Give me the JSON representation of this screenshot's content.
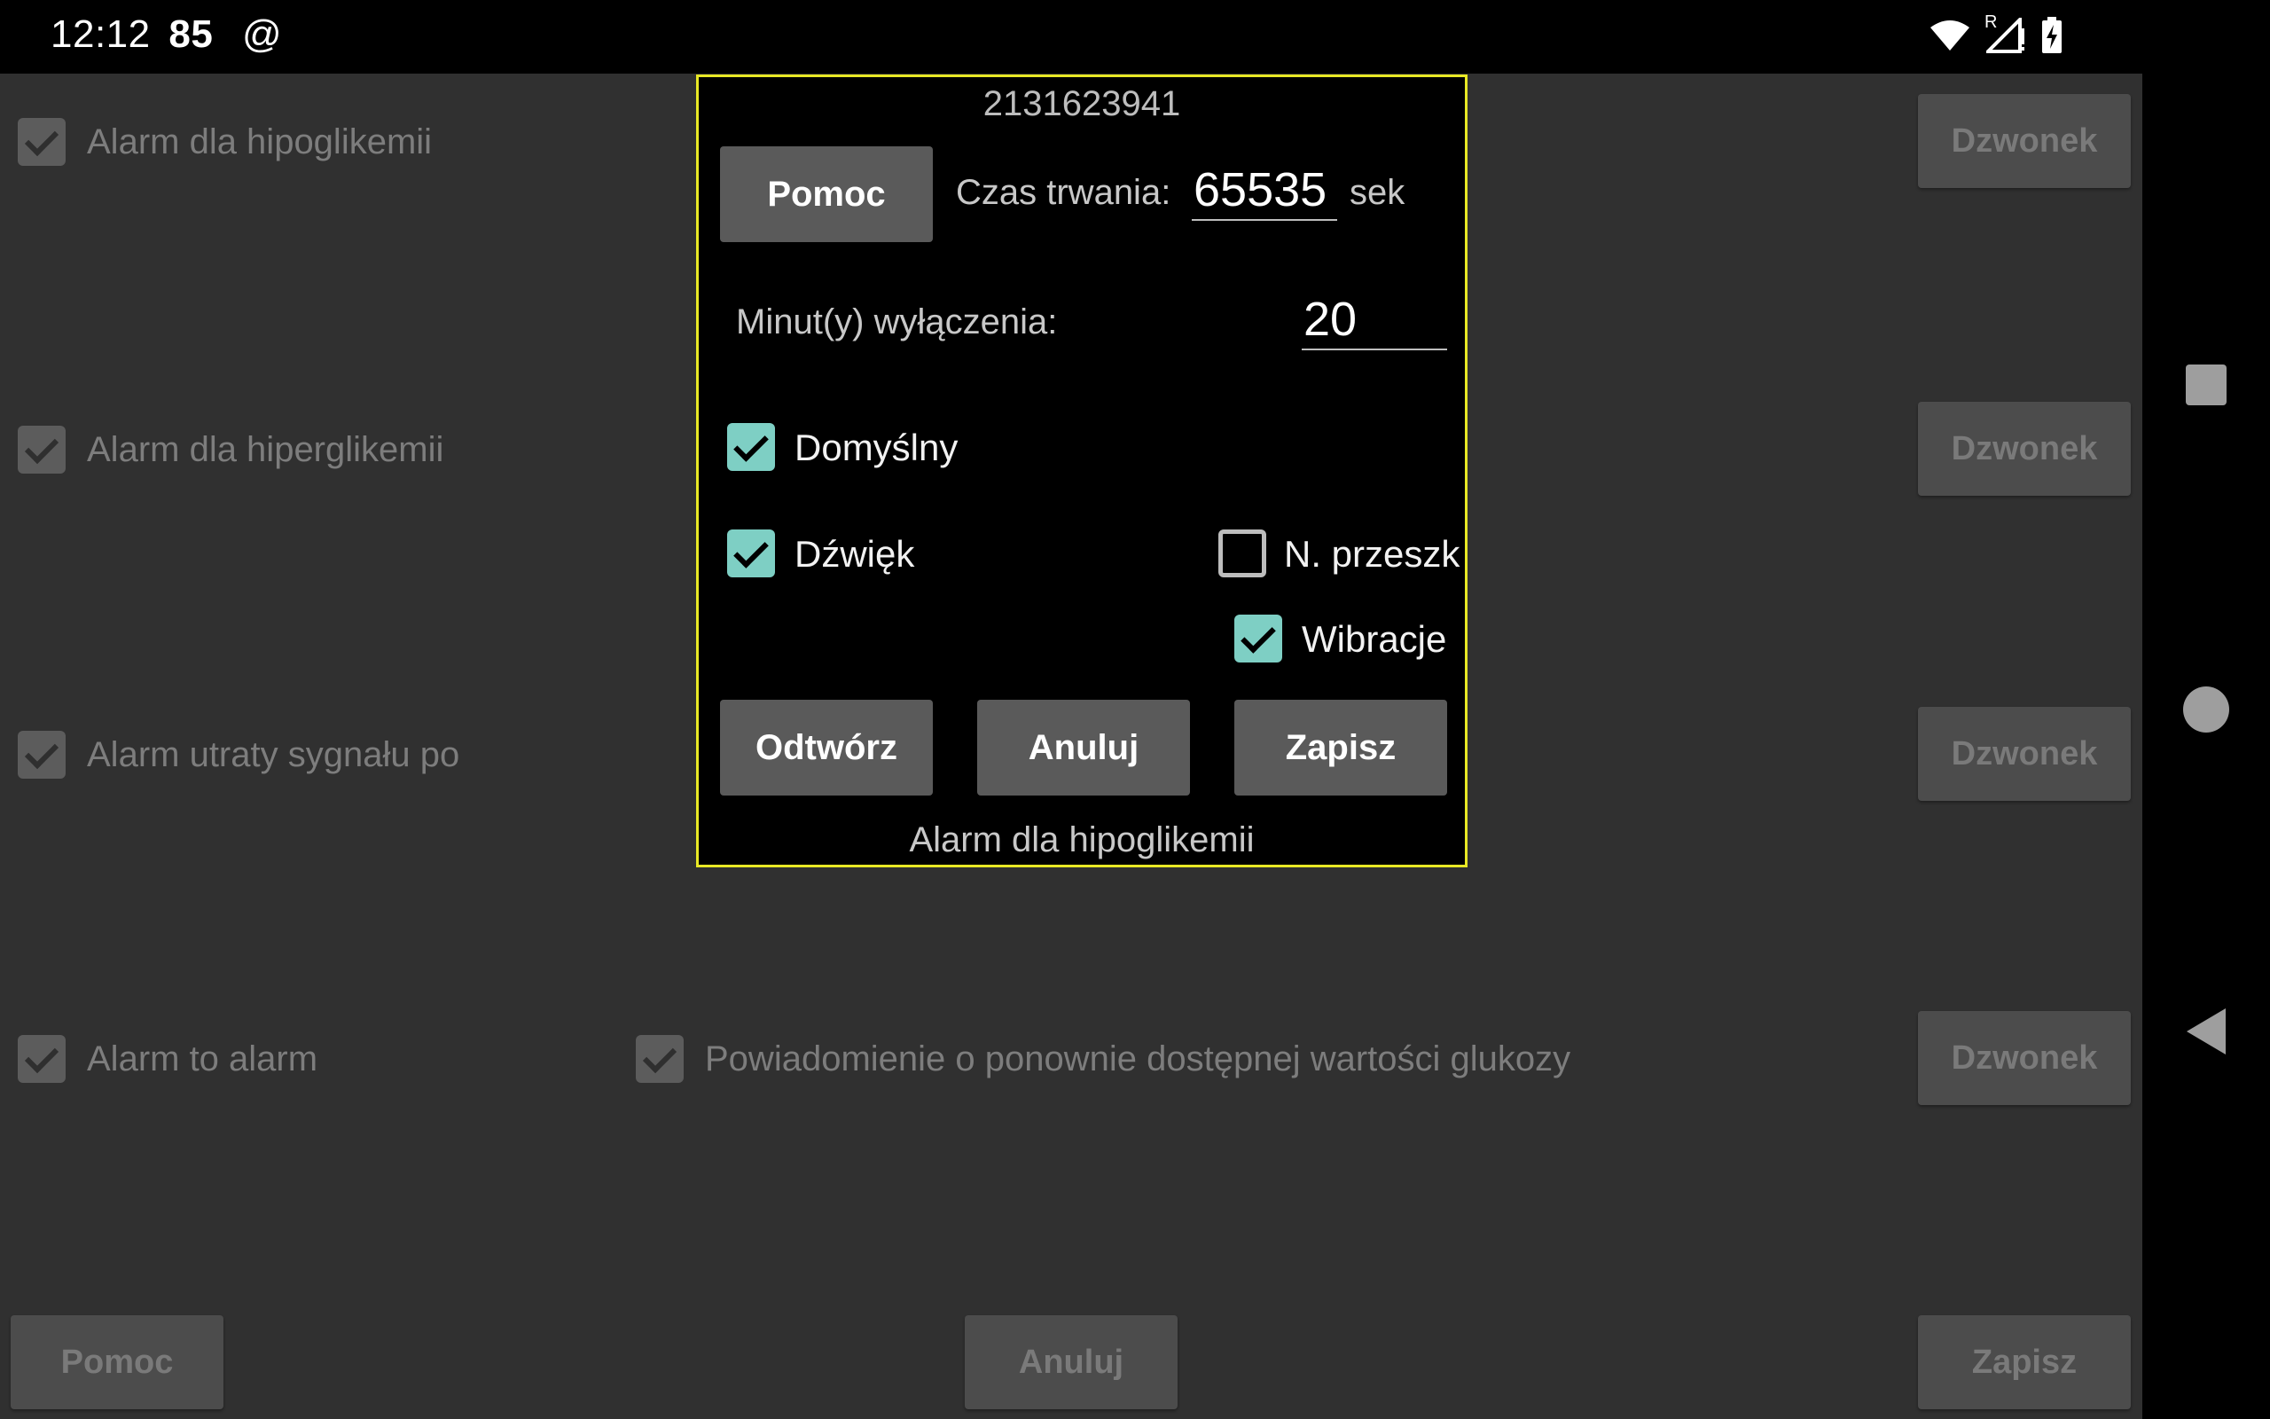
{
  "status_bar": {
    "time": "12:12",
    "extra": "85",
    "at": "@",
    "wifi_icon": "wifi-icon",
    "signal_icon": "signal-icon",
    "roaming_mark": "R",
    "battery_icon": "battery-charging-icon"
  },
  "background": {
    "rows": [
      {
        "label": "Alarm dla hipoglikemii",
        "button": "Dzwonek"
      },
      {
        "label": "Alarm dla hiperglikemii",
        "button": "Dzwonek"
      },
      {
        "label": "Alarm utraty sygnału po",
        "button": "Dzwonek"
      },
      {
        "label": "Alarm to alarm",
        "button": "Dzwonek"
      }
    ],
    "extra_check_label": "Powiadomienie o ponownie dostępnej wartości glukozy",
    "paren": ")",
    "footer": {
      "help": "Pomoc",
      "cancel": "Anuluj",
      "save": "Zapisz"
    }
  },
  "dialog": {
    "id": "2131623941",
    "help_button": "Pomoc",
    "duration_label": "Czas trwania:",
    "duration_value": "65535",
    "duration_unit": "sek",
    "snooze_label": "Minut(y) wyłączenia:",
    "snooze_value": "20",
    "default_label": "Domyślny",
    "default_checked": true,
    "sound_label": "Dźwięk",
    "sound_checked": true,
    "dnd_label": "N. przeszk",
    "dnd_checked": false,
    "vibration_label": "Wibracje",
    "vibration_checked": true,
    "play_button": "Odtwórz",
    "cancel_button": "Anuluj",
    "save_button": "Zapisz",
    "footer_title": "Alarm dla hipoglikemii"
  },
  "colors": {
    "dialog_border": "#e8e825",
    "check_accent": "#7ecfc4",
    "background": "#303030"
  }
}
